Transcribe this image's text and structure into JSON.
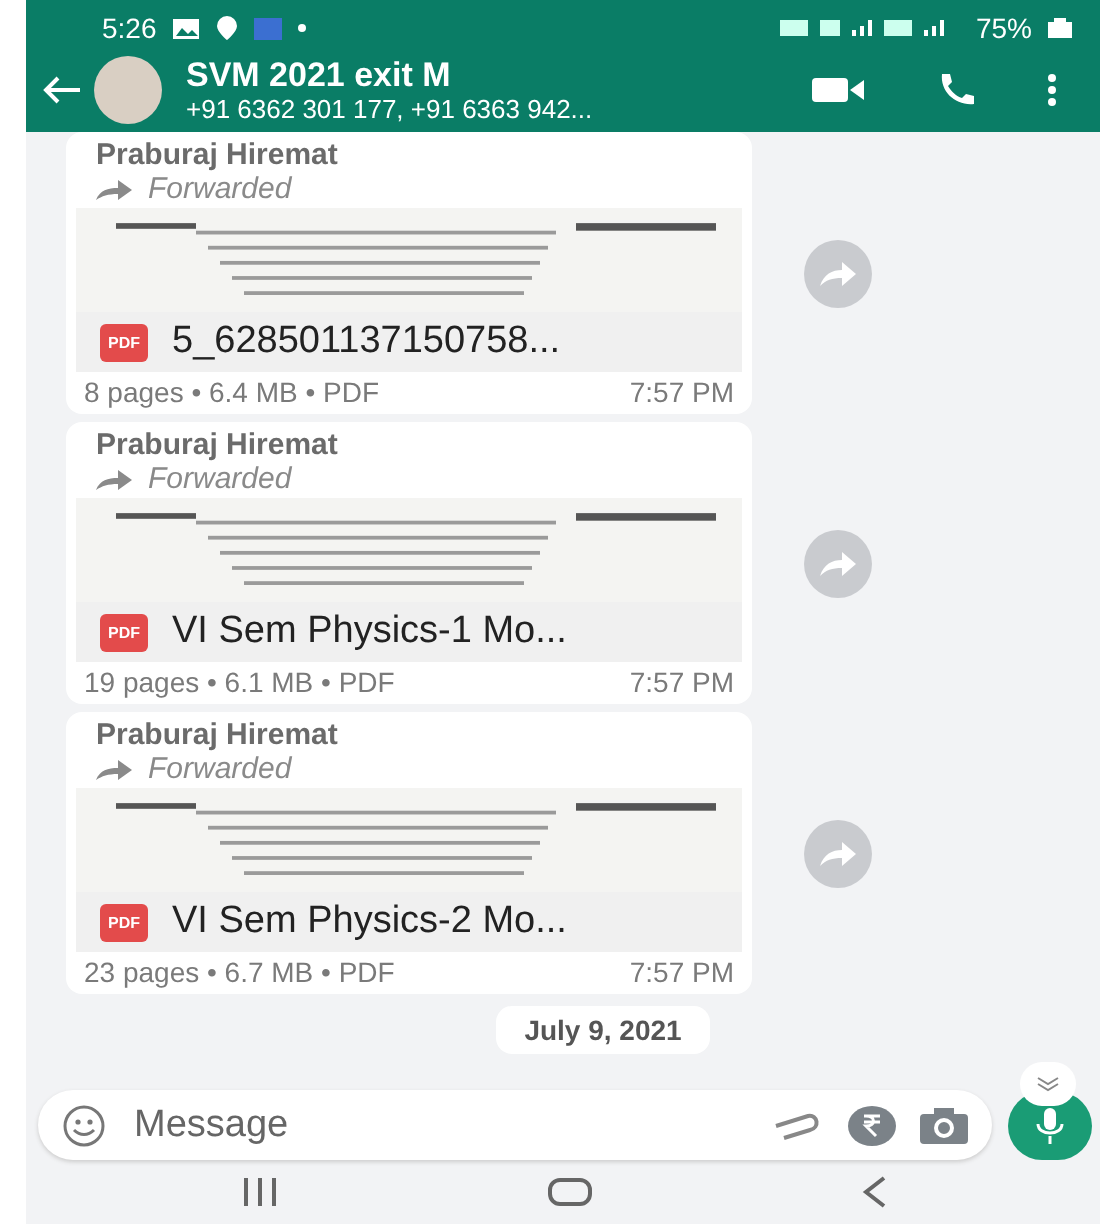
{
  "status_bar": {
    "time": "5:26",
    "battery": "75%"
  },
  "header": {
    "title": "SVM 2021 exit M",
    "subtitle": "+91 6362 301 177, +91 6363 942..."
  },
  "messages": [
    {
      "sender": "Praburaj Hiremat",
      "forwarded": "Forwarded",
      "file_type": "PDF",
      "file_name": "5_628501137150758...",
      "meta": "8 pages • 6.4 MB • PDF",
      "time": "7:57 PM"
    },
    {
      "sender": "Praburaj Hiremat",
      "forwarded": "Forwarded",
      "file_type": "PDF",
      "file_name": "VI Sem Physics-1 Mo...",
      "meta": "19 pages • 6.1 MB • PDF",
      "time": "7:57 PM"
    },
    {
      "sender": "Praburaj Hiremat",
      "forwarded": "Forwarded",
      "file_type": "PDF",
      "file_name": "VI Sem Physics-2 Mo...",
      "meta": "23 pages • 6.7 MB • PDF",
      "time": "7:57 PM"
    }
  ],
  "date_chip": "July 9, 2021",
  "composer": {
    "placeholder": "Message"
  }
}
